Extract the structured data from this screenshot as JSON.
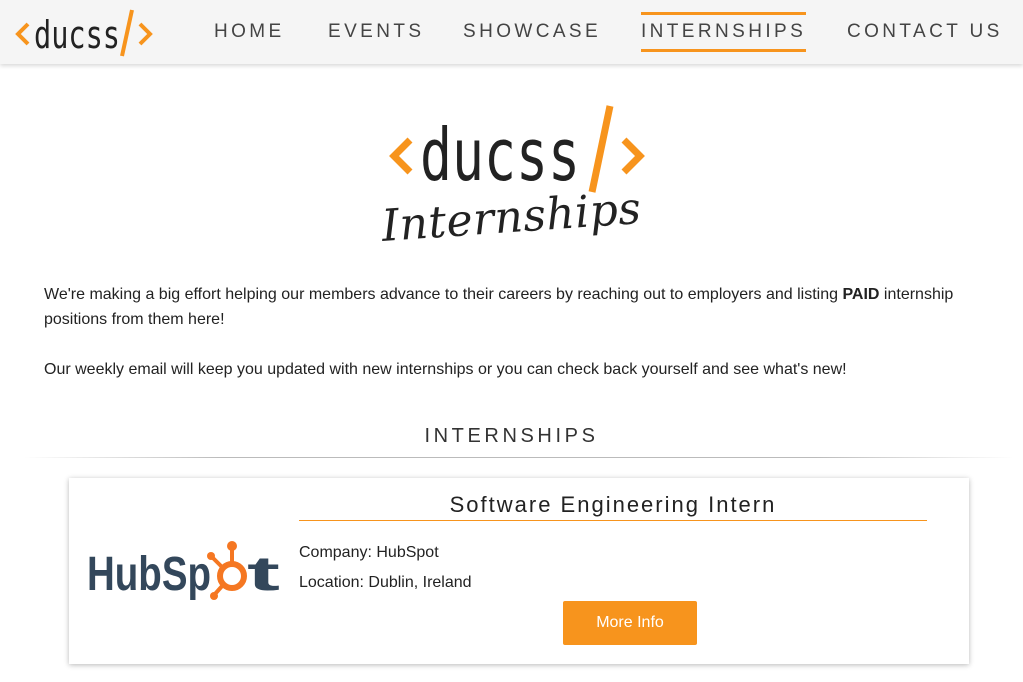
{
  "brand": {
    "logo_text": "ducss",
    "accent_color": "#f7941d",
    "dark_color": "#222222"
  },
  "nav": {
    "items": [
      {
        "label": "HOME",
        "active": false
      },
      {
        "label": "EVENTS",
        "active": false
      },
      {
        "label": "SHOWCASE",
        "active": false
      },
      {
        "label": "INTERNSHIPS",
        "active": true
      },
      {
        "label": "CONTACT US",
        "active": false
      }
    ]
  },
  "hero": {
    "logo_text": "ducss",
    "subtitle": "Internships"
  },
  "intro": {
    "p1_before": "We're making a big effort helping our members advance to their careers by reaching out to employers and listing ",
    "p1_bold": "PAID",
    "p1_after": " internship positions from them here!",
    "p2": "Our weekly email will keep you updated with new internships or you can check back yourself and see what's new!"
  },
  "section": {
    "title": "INTERNSHIPS"
  },
  "listing": {
    "company_logo_text": "HubSpot",
    "company_logo_color": "#33475b",
    "company_logo_accent": "#f57722",
    "title": "Software Engineering Intern",
    "company_label": "Company: HubSpot",
    "location_label": "Location: Dublin, Ireland",
    "button_label": "More Info"
  }
}
